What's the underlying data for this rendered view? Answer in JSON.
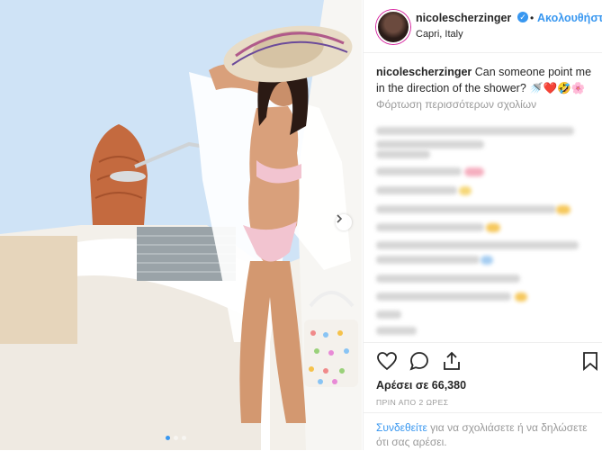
{
  "post": {
    "username": "nicolescherzinger",
    "verified_symbol": "✓",
    "separator": "•",
    "follow_label": "Ακολουθήστε",
    "location": "Capri, Italy",
    "caption_user": "nicolescherzinger",
    "caption_text": "Can someone point me in the direction of the shower? 🚿❤️🤣🌸",
    "load_more_label": "Φόρτωση περισσότερων σχολίων",
    "likes_label": "Αρέσει σε 66,380",
    "timestamp": "ΠΡΙΝ ΑΠΟ 2 ΩΡΕΣ",
    "login_link_label": "Συνδεθείτε",
    "login_rest_text": " για να σχολιάσετε ή να δηλώσετε ότι σας αρέσει."
  },
  "icons": {
    "like": "heart-icon",
    "comment": "comment-icon",
    "share": "share-icon",
    "save": "bookmark-icon",
    "next": "chevron-right-icon"
  },
  "carousel": {
    "slide_count": 3,
    "active_index": 0
  },
  "colors": {
    "accent": "#3897f0",
    "text": "#262626",
    "muted": "#999999",
    "border": "#efefef"
  }
}
